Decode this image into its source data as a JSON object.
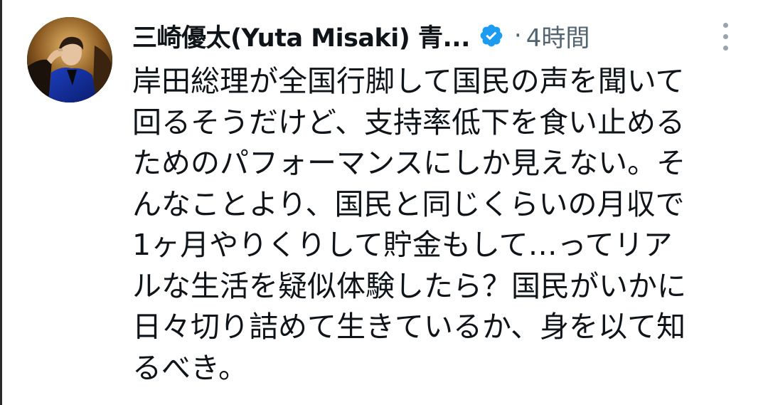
{
  "tweet": {
    "author": {
      "display_name": "三崎優太(Yuta Misaki) 青...",
      "verified_icon": "verified-badge-icon",
      "avatar": "avatar"
    },
    "separator": "·",
    "timestamp": "4時間",
    "more_icon": "more-vertical-icon",
    "text_lines": [
      "岸田総理が全国行脚して国民の声を聞いて",
      "回るそうだけど、支持率低下を食い止める",
      "ためのパフォーマンスにしか見えない。そ",
      "んなことより、国民と同じくらいの月収で",
      "1ヶ月やりくりして貯金もして…ってリア",
      "ルな生活を疑似体験したら？国民がいかに",
      "日々切り詰めて生きているか、身を以て知",
      "るべき。"
    ]
  },
  "colors": {
    "text": "#0f1419",
    "muted": "#536471",
    "verified": "#1d9bf0"
  }
}
